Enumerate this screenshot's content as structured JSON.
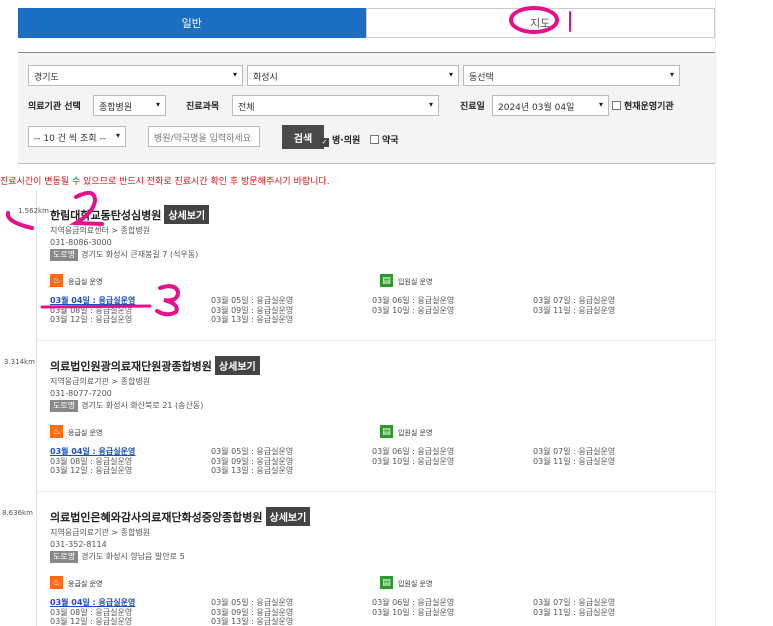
{
  "tabs": {
    "general": "일반",
    "map": "지도"
  },
  "filters": {
    "region": "경기도",
    "city": "화성시",
    "dong": "동선택",
    "facility_label": "의료기관 선택",
    "facility": "종합병원",
    "dept_label": "진료과목",
    "dept": "전체",
    "date_label": "진료일",
    "date": "2024년 03월 04일",
    "operating_label": "현재운영기관",
    "page_size": "-- 10 건 씩 조회 --",
    "search_placeholder": "병원/약국명을 입력하세요",
    "search_button": "검색",
    "hospital_label": "병·의원",
    "pharmacy_label": "약국"
  },
  "notice": "진료시간이 변동될 수 있으므로 반드시 전화로 진료시간 확인 후 방문해주시기 바랍니다.",
  "detail_label": "상세보기",
  "road_tag": "도로명",
  "er_label": "응급실 운영",
  "inpatient_label": "입원실 운영",
  "hospitals": [
    {
      "distance": "1.562km",
      "name": "한림대학교동탄성심병원",
      "category": "지역응급의료센터 > 종합병원",
      "phone": "031-8086-3000",
      "address": "경기도 화성시 큰재봉길 7 (석우동)",
      "schedule": [
        [
          "03월 04일 : 응급실운영",
          "03월 08일 : 응급실운영",
          "03월 12일 : 응급실운영"
        ],
        [
          "03월 05일 : 응급실운영",
          "03월 09일 : 응급실운영",
          "03월 13일 : 응급실운영"
        ],
        [
          "03월 06일 : 응급실운영",
          "03월 10일 : 응급실운영"
        ],
        [
          "03월 07일 : 응급실운영",
          "03월 11일 : 응급실운영"
        ]
      ]
    },
    {
      "distance": "3.314km",
      "name": "의료법인원광의료재단원광종합병원",
      "category": "지역응급의료기관 > 종합병원",
      "phone": "031-8077-7200",
      "address": "경기도 화성시 화산북로 21 (송산동)",
      "schedule": [
        [
          "03월 04일 : 응급실운영",
          "03월 08일 : 응급실운영",
          "03월 12일 : 응급실운영"
        ],
        [
          "03월 05일 : 응급실운영",
          "03월 09일 : 응급실운영",
          "03월 13일 : 응급실운영"
        ],
        [
          "03월 06일 : 응급실운영",
          "03월 10일 : 응급실운영"
        ],
        [
          "03월 07일 : 응급실운영",
          "03월 11일 : 응급실운영"
        ]
      ]
    },
    {
      "distance": "8.636km",
      "name": "의료법인은혜와감사의료재단화성중앙종합병원",
      "category": "지역응급의료기관 > 종합병원",
      "phone": "031-352-8114",
      "address": "경기도 화성시 향남읍 발안로 5",
      "schedule": [
        [
          "03월 04일 : 응급실운영",
          "03월 08일 : 응급실운영",
          "03월 12일 : 응급실운영"
        ],
        [
          "03월 05일 : 응급실운영",
          "03월 09일 : 응급실운영",
          "03월 13일 : 응급실운영"
        ],
        [
          "03월 06일 : 응급실운영",
          "03월 10일 : 응급실운영"
        ],
        [
          "03월 07일 : 응급실운영",
          "03월 11일 : 응급실운영"
        ]
      ]
    }
  ],
  "annotations": {
    "color": "#e8108a"
  }
}
